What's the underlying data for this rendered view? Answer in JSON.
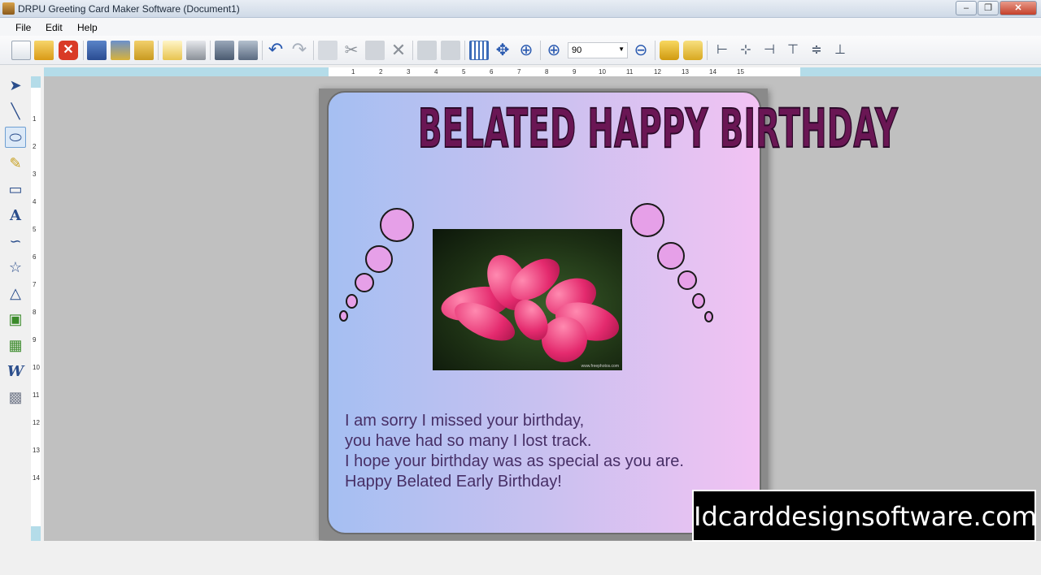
{
  "window": {
    "title": "DRPU Greeting Card Maker Software  (Document1)",
    "buttons": [
      "–",
      "❐",
      "✕"
    ]
  },
  "menu": {
    "items": [
      "File",
      "Edit",
      "Help"
    ]
  },
  "toolbar": {
    "zoom_value": "90"
  },
  "rulers": {
    "horizontal_ticks": [
      "1",
      "2",
      "3",
      "4",
      "5",
      "6",
      "7",
      "8",
      "9",
      "10",
      "11",
      "12",
      "13",
      "14",
      "15"
    ],
    "vertical_ticks": [
      "1",
      "2",
      "3",
      "4",
      "5",
      "6",
      "7",
      "8",
      "9",
      "10",
      "11",
      "12",
      "13",
      "14"
    ]
  },
  "card": {
    "headline": "BELATED HAPPY BIRTHDAY",
    "photo_credit": "www.freephotos.com",
    "message_lines": [
      "I am sorry I missed your birthday,",
      "you have had so many I lost track.",
      "I hope your birthday was as special as you are.",
      "Happy Belated Early Birthday!"
    ]
  },
  "watermark": "Idcarddesignsoftware.com",
  "colors": {
    "headline": "#6a1654",
    "bubble": "#e6a0e8",
    "message": "#472f66",
    "card_gradient_left": "#a5bff2",
    "card_gradient_right": "#f2c2f3"
  }
}
